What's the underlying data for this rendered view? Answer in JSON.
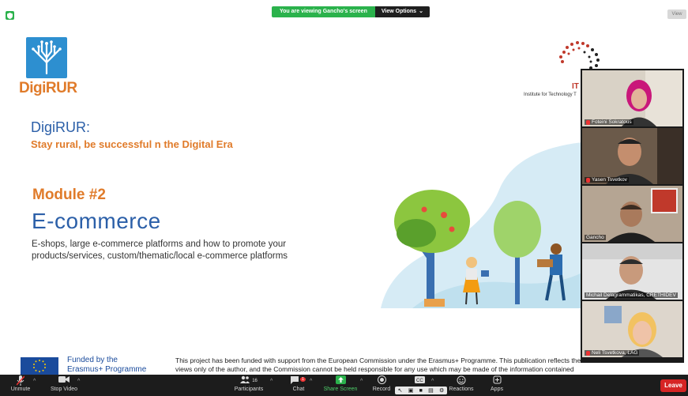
{
  "top_bar": {
    "viewing_text": "You are viewing Gancho's screen",
    "view_options_label": "View Options",
    "view_button_label": "View"
  },
  "slide": {
    "logo_name": "DigiRUR",
    "itt_logo_text": "IT",
    "itt_subtitle": "Institute for Technology T",
    "heading": "DigiRUR:",
    "tagline": "Stay rural, be successful n the Digital Era",
    "module": "Module #2",
    "title": "E-commerce",
    "description": "E-shops, large e-commerce platforms and how to promote your products/services, custom/thematic/local e-commerce platforms",
    "funded_by": "Funded by the Erasmus+ Programme",
    "disclaimer": "This project has been funded with support from the European Commission under the Erasmus+ Programme. This publication reflects the views only of the author, and the Commission cannot be held responsible for any use which may be made of the information contained"
  },
  "participants": [
    {
      "name": "Foteini Sokratous",
      "muted": true,
      "active": false
    },
    {
      "name": "Yasen Tsvetkov",
      "muted": true,
      "active": false
    },
    {
      "name": "Gancho",
      "muted": false,
      "active": true
    },
    {
      "name": "Michail Delagrammatikas, CRETHIDEV",
      "muted": false,
      "active": false
    },
    {
      "name": "Neli Tsvetkova, LAG",
      "muted": true,
      "active": false
    }
  ],
  "toolbar": {
    "unmute": "Unmute",
    "stop_video": "Stop Video",
    "participants": "Participants",
    "participants_count": "16",
    "chat": "Chat",
    "chat_badge": "1",
    "share_screen": "Share Screen",
    "record": "Record",
    "reactions": "Reactions",
    "apps": "Apps",
    "leave": "Leave"
  },
  "colors": {
    "accent_green": "#2bb24c",
    "leave_red": "#d62424",
    "slide_orange": "#e07b2a",
    "slide_blue": "#2b5fa8"
  }
}
